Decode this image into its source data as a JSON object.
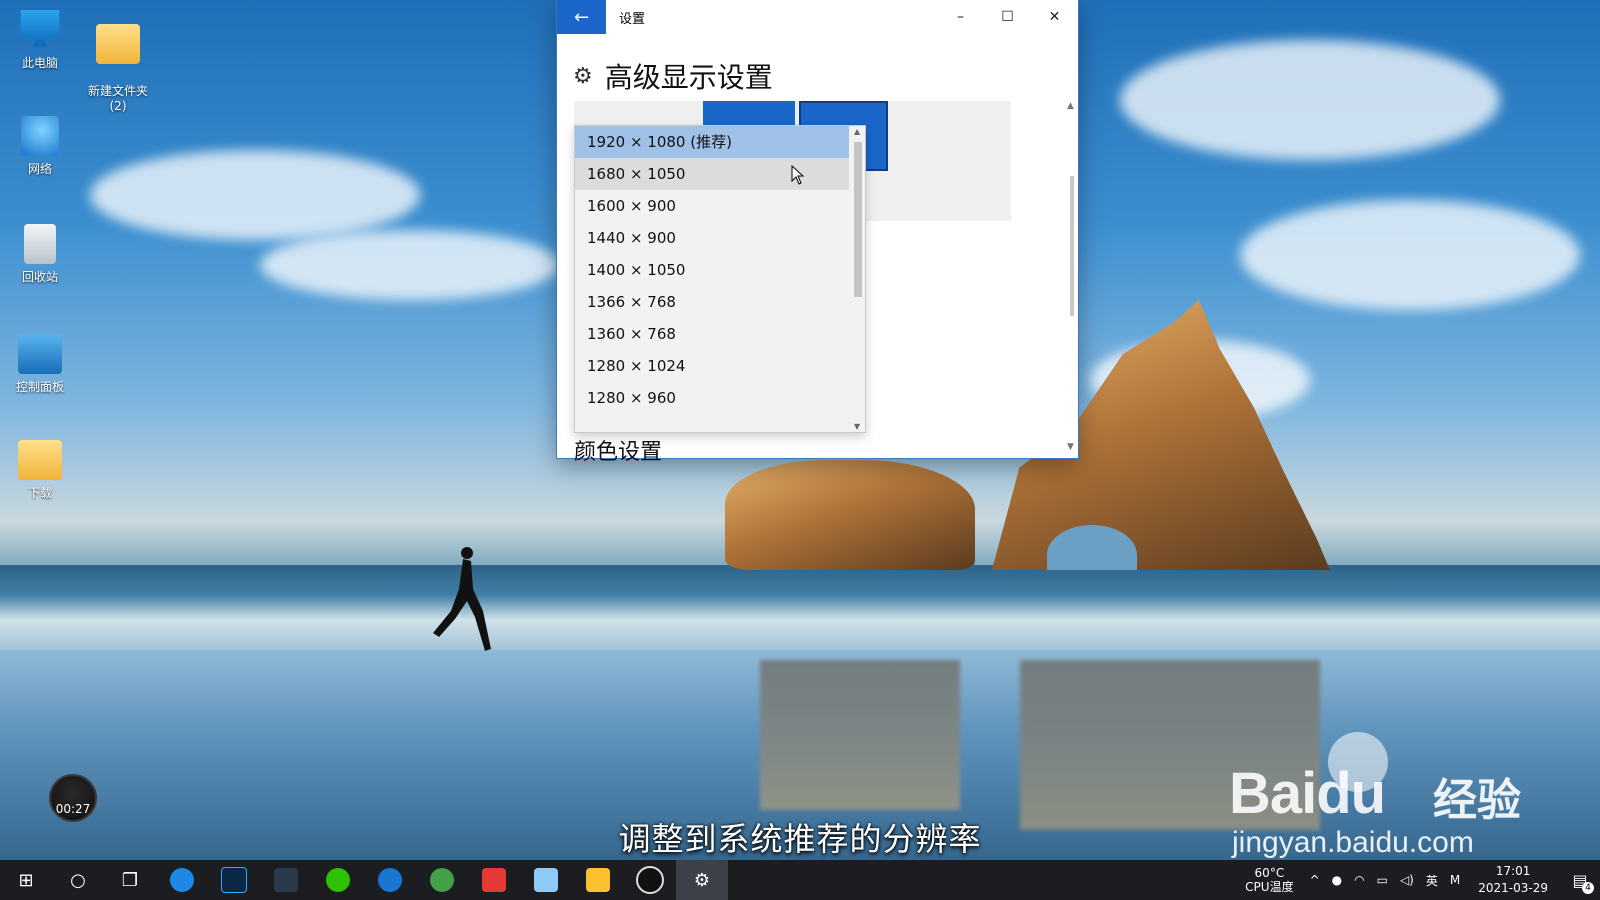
{
  "desktop": {
    "icons": [
      {
        "label": "此电脑",
        "icon": "computer-icon"
      },
      {
        "label": "新建文件夹\n(2)",
        "icon": "folder-icon"
      },
      {
        "label": "网络",
        "icon": "network-icon"
      },
      {
        "label": "回收站",
        "icon": "recycle-bin-icon"
      },
      {
        "label": "控制面板",
        "icon": "control-panel-icon"
      },
      {
        "label": "下载",
        "icon": "download-folder-icon"
      }
    ]
  },
  "window": {
    "title": "设置",
    "back_glyph": "←",
    "minimize_glyph": "–",
    "maximize_glyph": "☐",
    "close_glyph": "✕",
    "heading": "高级显示设置",
    "section_color": "颜色设置"
  },
  "resolution_dropdown": {
    "options": [
      "1920 × 1080 (推荐)",
      "1680 × 1050",
      "1600 × 900",
      "1440 × 900",
      "1400 × 1050",
      "1366 × 768",
      "1360 × 768",
      "1280 × 1024",
      "1280 × 960"
    ],
    "selected_index": 0,
    "hover_index": 1
  },
  "video": {
    "timer": "00:27",
    "subtitle": "调整到系统推荐的分辨率"
  },
  "watermark": {
    "logo": "Baidu",
    "brand": "经验",
    "url": "jingyan.baidu.com"
  },
  "taskbar": {
    "apps": [
      "start-icon",
      "search-icon",
      "task-view-icon",
      "sogou-icon",
      "photoshop-icon",
      "download-manager-icon",
      "wechat-icon",
      "browser-icon",
      "green-browser-icon",
      "wps-icon",
      "notepad-icon",
      "file-explorer-icon",
      "music-icon",
      "settings-icon"
    ],
    "cpu_temp": "60°C",
    "cpu_label": "CPU温度",
    "ime": "英",
    "time": "17:01",
    "date": "2021-03-29",
    "notification_count": "4"
  },
  "colors": {
    "accent": "#1a66c9",
    "selected_option": "#9fc1e8",
    "taskbar": "#1b1d21"
  }
}
